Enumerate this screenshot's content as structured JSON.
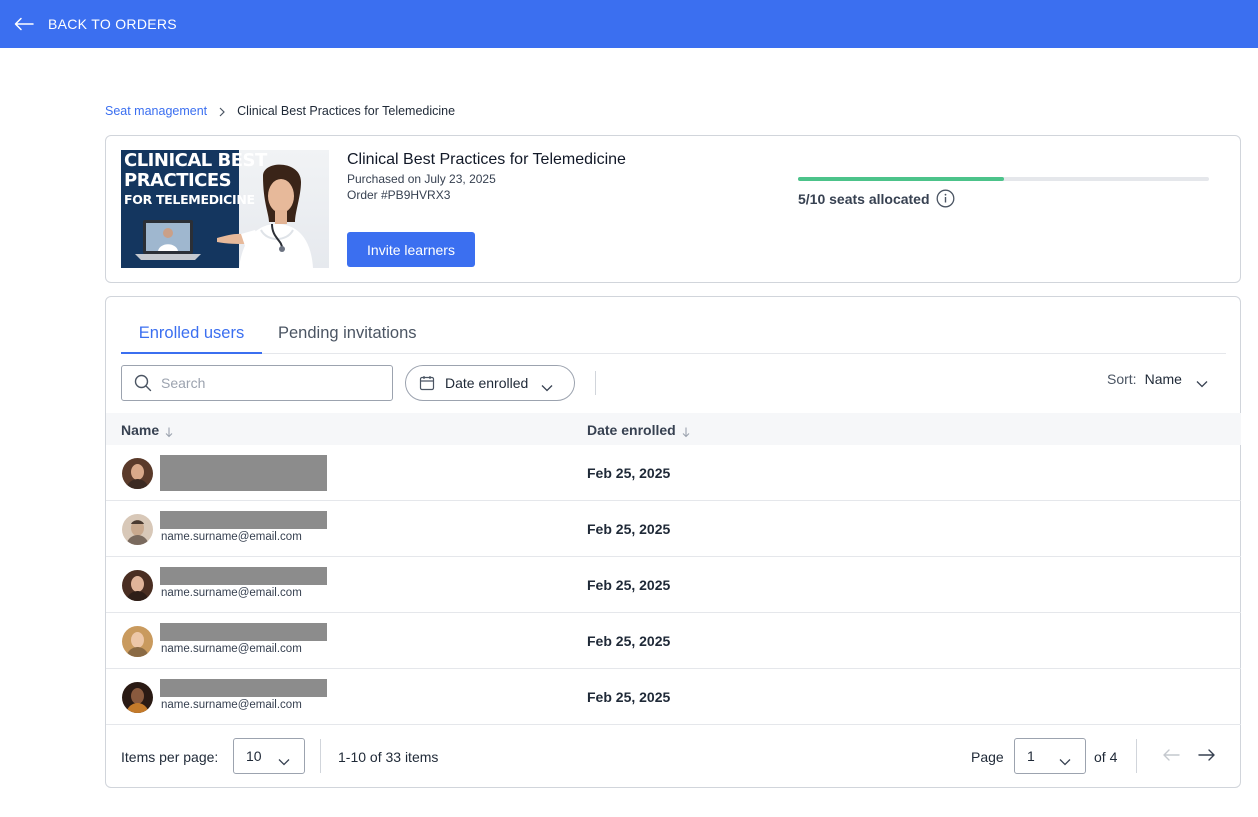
{
  "topbar": {
    "back_label": "BACK TO ORDERS",
    "back_icon": "arrow-left-icon",
    "color": "#3B6FF0"
  },
  "breadcrumb": {
    "parent": "Seat management",
    "current": "Clinical Best Practices for Telemedicine"
  },
  "product": {
    "thumbnail_line1": "CLINICAL BEST",
    "thumbnail_line2": "PRACTICES",
    "thumbnail_line3": "FOR TELEMEDICINE",
    "title": "Clinical Best Practices for Telemedicine",
    "purchased": "Purchased on July 23, 2025",
    "order": "Order #PB9HVRX3",
    "invite_label": "Invite learners",
    "seats_label": "5/10 seats allocated",
    "seats_used": 5,
    "seats_total": 10,
    "progress_color": "#4CC38A"
  },
  "tabs": [
    {
      "label": "Enrolled users",
      "active": true
    },
    {
      "label": "Pending invitations",
      "active": false
    }
  ],
  "toolbar": {
    "search_placeholder": "Search",
    "filter_label": "Date enrolled",
    "sort_prefix": "Sort:",
    "sort_value": "Name"
  },
  "table": {
    "columns": [
      "Name",
      "Date enrolled"
    ],
    "rows": [
      {
        "email": "",
        "date": "Feb 25, 2025",
        "avatar_bg": "#5a3a2a"
      },
      {
        "email": "name.surname@email.com",
        "date": "Feb 25, 2025",
        "avatar_bg": "#c9a98e"
      },
      {
        "email": "name.surname@email.com",
        "date": "Feb 25, 2025",
        "avatar_bg": "#4a2e22"
      },
      {
        "email": "name.surname@email.com",
        "date": "Feb 25, 2025",
        "avatar_bg": "#c99a5e"
      },
      {
        "email": "name.surname@email.com",
        "date": "Feb 25, 2025",
        "avatar_bg": "#2a1a14"
      }
    ]
  },
  "pagination": {
    "items_per_page_label": "Items per page:",
    "items_per_page": "10",
    "range": "1-10 of 33 items",
    "page_label": "Page",
    "page": "1",
    "of_pages": "of 4"
  }
}
